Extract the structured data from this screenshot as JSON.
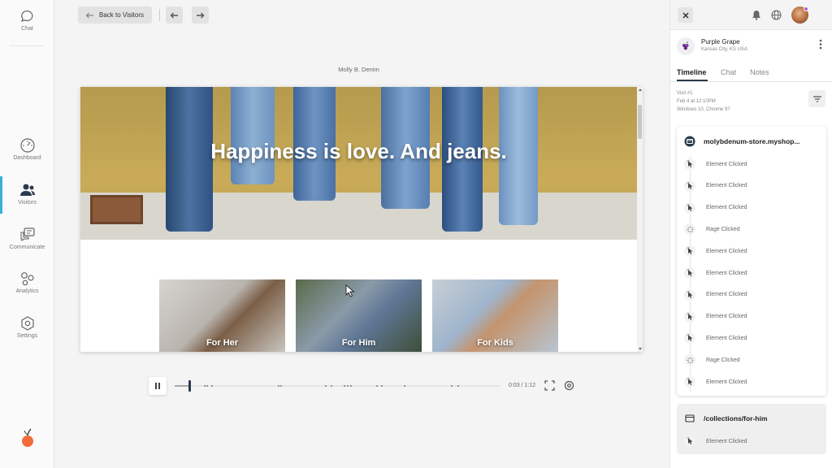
{
  "sidebar": {
    "items": [
      {
        "label": "Chat",
        "icon": "chat-icon"
      },
      {
        "label": "Dashboard",
        "icon": "dashboard-icon"
      },
      {
        "label": "Visitors",
        "icon": "visitors-icon",
        "active": true
      },
      {
        "label": "Communicate",
        "icon": "communicate-icon"
      },
      {
        "label": "Analytics",
        "icon": "analytics-icon"
      },
      {
        "label": "Settings",
        "icon": "settings-icon"
      }
    ]
  },
  "toolbar": {
    "back_label": "Back to Visitors"
  },
  "replay": {
    "site_title": "Molly B. Denim",
    "hero_heading": "Happiness is love. And jeans.",
    "categories": [
      "For Her",
      "For Him",
      "For Kids"
    ],
    "time": "0:03 / 1:12",
    "progress": 0.045
  },
  "panel": {
    "visitor_name": "Purple Grape",
    "visitor_location": "Kansas City, KS USA",
    "tabs": [
      "Timeline",
      "Chat",
      "Notes"
    ],
    "visit": {
      "number": "Visit #1",
      "date": "Feb 4 at 12:10PM",
      "system": "Windows 10, Chrome 97"
    },
    "sessions": [
      {
        "page": "molybdenum-store.myshop...",
        "events": [
          "Element Clicked",
          "Element Clicked",
          "Element Clicked",
          "Rage Clicked",
          "Element Clicked",
          "Element Clicked",
          "Element Clicked",
          "Element Clicked",
          "Element Clicked",
          "Rage Clicked",
          "Element Clicked"
        ]
      },
      {
        "page": "/collections/for-him",
        "events": [
          "Element Clicked"
        ]
      }
    ]
  },
  "colors": {
    "accent": "#3ab0d8",
    "nav_dark": "#2b3a4e",
    "logo": "#f26b3a",
    "avatar_badge": "#b35ad6"
  }
}
